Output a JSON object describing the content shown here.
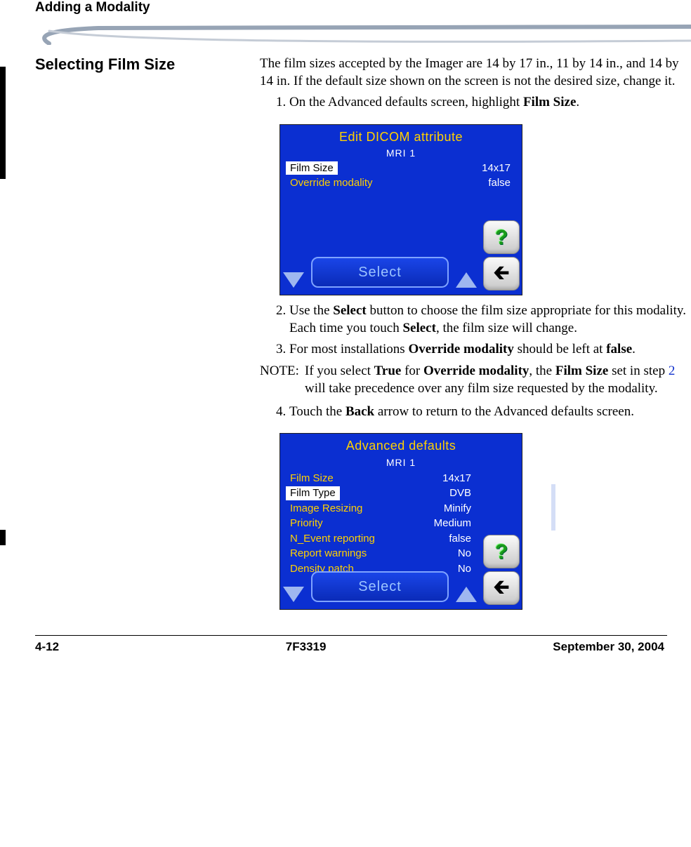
{
  "header": {
    "title": "Adding a Modality"
  },
  "section": {
    "heading": "Selecting Film Size",
    "intro": "The film sizes accepted by the Imager are 14 by 17 in., 11 by 14 in., and 14 by 14 in. If the default size shown on the screen is not the desired size, change it.",
    "step1_pre": "On the Advanced defaults screen, highlight ",
    "step1_bold": "Film Size",
    "step1_post": ".",
    "step2_a": "Use the ",
    "step2_b": "Select",
    "step2_c": " button to choose the film size appropriate for this modality. Each time you touch ",
    "step2_d": "Select",
    "step2_e": ", the film size will change.",
    "step3_a": "For most installations ",
    "step3_b": "Override modality",
    "step3_c": " should be left at ",
    "step3_d": "false",
    "step3_e": ".",
    "note_label": "NOTE:",
    "note_a": "If you select ",
    "note_b": "True",
    "note_c": " for ",
    "note_d": "Override modality",
    "note_e": ", the ",
    "note_f": "Film Size",
    "note_g": " set in step ",
    "note_ref": "2",
    "note_h": " will take precedence over any film size requested by the modality.",
    "step4_a": "Touch the ",
    "step4_b": "Back",
    "step4_c": " arrow to return to the Advanced defaults screen."
  },
  "panel1": {
    "title": "Edit DICOM attribute",
    "sub": "MRI 1",
    "rows": [
      {
        "label": "Film Size",
        "value": "14x17",
        "highlight": true,
        "label_color": "highlight",
        "value_color": "white"
      },
      {
        "label": "Override modality",
        "value": "false",
        "highlight": false,
        "label_color": "yellow",
        "value_color": "white"
      }
    ],
    "select": "Select",
    "help": "?",
    "back": "←"
  },
  "panel2": {
    "title": "Advanced defaults",
    "sub": "MRI 1",
    "rows": [
      {
        "label": "Film Size",
        "value": "14x17",
        "label_color": "yellow",
        "value_color": "white"
      },
      {
        "label": "Film Type",
        "value": "DVB",
        "label_color": "highlight",
        "value_color": "white"
      },
      {
        "label": "Image Resizing",
        "value": "Minify",
        "label_color": "yellow",
        "value_color": "white"
      },
      {
        "label": "Priority",
        "value": "Medium",
        "label_color": "yellow",
        "value_color": "white"
      },
      {
        "label": "N_Event reporting",
        "value": "false",
        "label_color": "yellow",
        "value_color": "white"
      },
      {
        "label": "Report warnings",
        "value": "No",
        "label_color": "yellow",
        "value_color": "white"
      },
      {
        "label": "Density patch",
        "value": "No",
        "label_color": "yellow",
        "value_color": "white"
      }
    ],
    "select": "Select",
    "help": "?",
    "back": "←"
  },
  "footer": {
    "left": "4-12",
    "center": "7F3319",
    "right": "September 30, 2004"
  }
}
